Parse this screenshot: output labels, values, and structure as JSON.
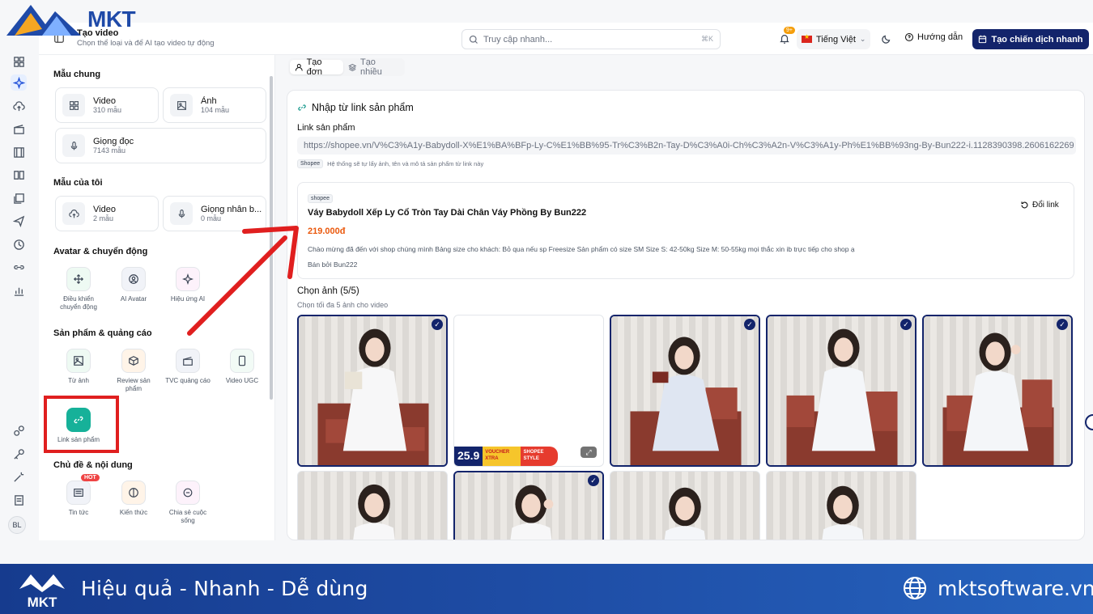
{
  "brand": {
    "logo_text": "MKT"
  },
  "header": {
    "title": "Tạo video",
    "subtitle": "Chọn thể loại và để AI tạo video tự động",
    "search_placeholder": "Truy cập nhanh...",
    "search_shortcut": "⌘K",
    "notif_badge": "9+",
    "language": "Tiếng Việt",
    "guide": "Hướng dẫn",
    "cta": "Tạo chiến dịch nhanh"
  },
  "user": {
    "initials": "BL"
  },
  "panel": {
    "common_title": "Mẫu chung",
    "common": [
      {
        "name": "Video",
        "count": "310 mẫu"
      },
      {
        "name": "Ảnh",
        "count": "104 mẫu"
      },
      {
        "name": "Giọng đọc",
        "count": "7143 mẫu"
      }
    ],
    "mine_title": "Mẫu của tôi",
    "mine": [
      {
        "name": "Video",
        "count": "2 mẫu"
      },
      {
        "name": "Giọng nhân b...",
        "count": "0 mẫu"
      }
    ],
    "avatar_title": "Avatar & chuyển động",
    "avatar_tiles": [
      "Điều khiển chuyển động",
      "AI Avatar",
      "Hiệu ứng AI"
    ],
    "product_title": "Sản phẩm & quảng cáo",
    "product_tiles": [
      "Từ ảnh",
      "Review sản phẩm",
      "TVC quảng cáo",
      "Video UGC"
    ],
    "link_tile": "Link sản phẩm",
    "topic_title": "Chủ đề & nội dung",
    "topic_tiles": [
      "Tin tức",
      "Kiến thức",
      "Chia sẻ cuộc sống"
    ],
    "hot_badge": "HOT"
  },
  "main": {
    "tabs": [
      "Tạo đơn",
      "Tạo nhiều"
    ],
    "heading": "Nhập từ link sản phẩm",
    "link_label": "Link sản phẩm",
    "link_value": "https://shopee.vn/V%C3%A1y-Babydoll-X%E1%BA%BFp-Ly-C%E1%BB%95-Tr%C3%B2n-Tay-D%C3%A0i-Ch%C3%A2n-V%C3%A1y-Ph%E1%BB%93ng-By-Bun222-i.1128390398.2606162269",
    "hint_chip": "Shopee",
    "hint_text": "Hệ thống sẽ tự lấy ảnh, tên và mô tả sản phẩm từ link này",
    "product": {
      "platform": "shopee",
      "title": "Váy Babydoll Xếp Ly Cổ Tròn Tay Dài Chân Váy Phồng By Bun222",
      "price": "219.000đ",
      "description": "Chào mừng đã đến với shop chúng mình Bảng size cho khách: Bỏ qua nếu sp Freesize Sản phẩm có size SM Size S: 42-50kg Size M: 50-55kg mọi thắc xin ib trực tiếp cho shop ạ",
      "seller": "Bán bởi Bun222",
      "relink": "Đổi link"
    },
    "images_title": "Chọn ảnh (5/5)",
    "images_sub": "Chọn tối đa 5 ảnh cho video",
    "promo": {
      "num": "25.9",
      "tag": "VOUCHER XTRA",
      "tag2": "SHOPEE STYLE"
    }
  },
  "footer": {
    "slogan": "Hiệu quả - Nhanh - Dễ dùng",
    "site": "mktsoftware.vn"
  },
  "colors": {
    "brand_navy": "#13246b",
    "price": "#ea580c",
    "annotation_red": "#e01f1f",
    "banner": "#1f4fa8"
  }
}
